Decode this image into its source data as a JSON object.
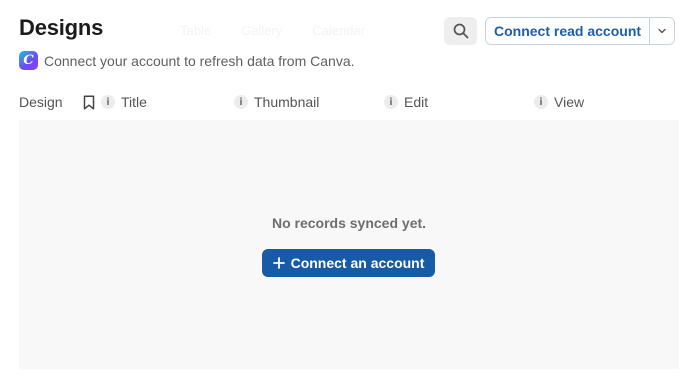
{
  "header": {
    "title": "Designs",
    "ghost_tabs": [
      "Table",
      "Gallery",
      "Calendar"
    ],
    "search_icon": "search-icon",
    "connect_label": "Connect read account",
    "connect_caret_icon": "chevron-down-icon"
  },
  "subtitle": {
    "logo_letter": "C",
    "text": "Connect your account to refresh data from Canva."
  },
  "table": {
    "columns": [
      {
        "label": "Design"
      },
      {
        "label": "Title"
      },
      {
        "label": "Thumbnail"
      },
      {
        "label": "Edit"
      },
      {
        "label": "View"
      }
    ],
    "info_glyph": "i",
    "empty_text": "No records synced yet.",
    "cta_label": "Connect an account"
  },
  "colors": {
    "accent": "#175aa6",
    "link": "#1c5ea8",
    "body_bg": "#f8f8f8"
  }
}
